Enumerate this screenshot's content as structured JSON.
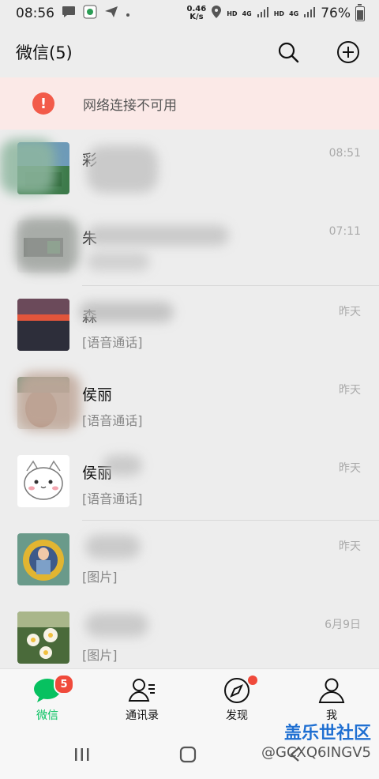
{
  "status_bar": {
    "time": "08:56",
    "network_speed_value": "0.46",
    "network_speed_unit": "K/s",
    "hd_label": "HD",
    "lte_label": "4G",
    "battery_percent": "76%"
  },
  "header": {
    "title": "微信(5)"
  },
  "network_banner": {
    "icon_text": "!",
    "text": "网络连接不可用"
  },
  "chats": [
    {
      "name": "彩",
      "preview": "",
      "time": "08:51"
    },
    {
      "name": "朱",
      "preview": "",
      "time": "07:11"
    },
    {
      "name": "森",
      "preview": "[语音通话]",
      "time": "昨天"
    },
    {
      "name": "侯丽",
      "preview": "[语音通话]",
      "time": "昨天"
    },
    {
      "name": "侯丽",
      "preview": "[语音通话]",
      "time": "昨天"
    },
    {
      "name": "",
      "preview": "[图片]",
      "time": "昨天"
    },
    {
      "name": "",
      "preview": "[图片]",
      "time": "6月9日"
    }
  ],
  "tabs": [
    {
      "label": "微信",
      "badge": "5",
      "active": true
    },
    {
      "label": "通讯录"
    },
    {
      "label": "发现"
    },
    {
      "label": "我"
    }
  ],
  "watermark": {
    "logo_text": "盖乐世社区",
    "user_id": "@GCXQ6INGV5"
  },
  "colors": {
    "accent": "#07c160",
    "badge": "#f04a3b",
    "banner_bg": "#fbe9e7",
    "banner_icon": "#f25b4a"
  }
}
